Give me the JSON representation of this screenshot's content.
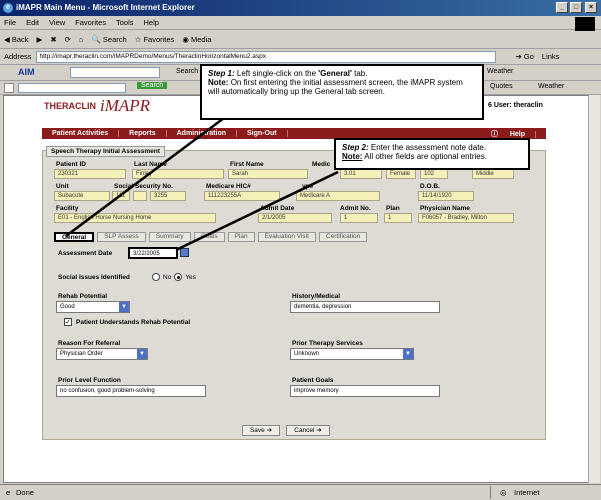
{
  "window": {
    "title": "iMAPR Main Menu - Microsoft Internet Explorer"
  },
  "menu": [
    "File",
    "Edit",
    "View",
    "Favorites",
    "Tools",
    "Help"
  ],
  "toolbar": {
    "back": "Back",
    "search": "Search",
    "favorites": "Favorites",
    "media": "Media"
  },
  "address": {
    "label": "Address",
    "url": "http://imapr.theraclin.com/iMAPRDemo/Menus/TheraclinHorizontalMenu2.aspx",
    "go": "Go",
    "links": "Links"
  },
  "aim": {
    "label": "AIM",
    "search": "Search",
    "weather": "Weather"
  },
  "bar3": {
    "search": "Search",
    "quotes": "Quotes",
    "weather": "Weather"
  },
  "app": {
    "logo_small": "THERACLIN",
    "logo_big": "iMAPR",
    "user": "6 User: theraclin",
    "nav": [
      "Patient Activities",
      "Reports",
      "Administration",
      "Sign-Out"
    ],
    "help": "Help",
    "section_title": "Speech Therapy Initial Assessment",
    "fields_row1": {
      "patient_id_label": "Patient ID",
      "patient_id": "230321",
      "last_name_label": "Last Name",
      "last_name": "Finley",
      "first_name_label": "First Name",
      "first_name": "Sarah",
      "medical_label": "Medic",
      "medical_val": "3.01",
      "gender": "Female",
      "room": "102",
      "middle_label": "Middle"
    },
    "fields_row2": {
      "unit_label": "Unit",
      "unit": "Subacute",
      "ssn_label": "Social Security No.",
      "ssn1": "111",
      "ssn3": "3255",
      "hic_label": "Medicare HIC#",
      "hic": "111223255A",
      "type_label": "ype",
      "type_val": "Medicare A",
      "dob_label": "D.O.B.",
      "dob": "11/14/1920"
    },
    "fields_row3": {
      "facility_label": "Facility",
      "facility": "E01 - English Horse Nursing Home",
      "admit_label": "Admit Date",
      "admit": "2/1/2005",
      "admit_no_label": "Admit No.",
      "admit_no": "1",
      "plan_label": "Plan",
      "plan": "1",
      "physician_label": "Physician Name",
      "physician": "F06057 - Bradley, Milton"
    },
    "tabs": [
      "General",
      "SLP Assess",
      "Summary",
      "Goals",
      "Plan",
      "Evaluation Visit",
      "Certification"
    ],
    "assessment_date_label": "Assessment Date",
    "assessment_date": "3/22/2005",
    "social_label": "Social Issues Identified",
    "no_label": "No",
    "yes_label": "Yes",
    "rehab_label": "Rehab Potential",
    "rehab_value": "Good",
    "understands_label": "Patient Understands Rehab Potential",
    "history_label": "History/Medical",
    "history_value": "dementia, depression",
    "referral_label": "Reason For Referral",
    "referral_value": "Physician Order",
    "prior_services_label": "Prior Therapy Services",
    "prior_services_value": "Unknown",
    "prior_level_label": "Prior Level Function",
    "prior_level_value": "no confusion, good problem-solving",
    "goals_label": "Patient Goals",
    "goals_value": "improve memory",
    "save": "Save",
    "cancel": "Cancel"
  },
  "callouts": {
    "step1_title": "Step 1:",
    "step1_text": "Left single-click on the ",
    "step1_bold": "'General'",
    "step1_tail": " tab.",
    "note1_label": "Note:",
    "note1_text": "On first entering the initial assessment screen, the iMAPR system will automatically bring up the General tab screen.",
    "step2_title": "Step 2:",
    "step2_text": "Enter the assessment note date.",
    "note2_label": "Note:",
    "note2_text": "All other fields are optional entries."
  },
  "status": {
    "done": "Done",
    "zone": "Internet"
  }
}
